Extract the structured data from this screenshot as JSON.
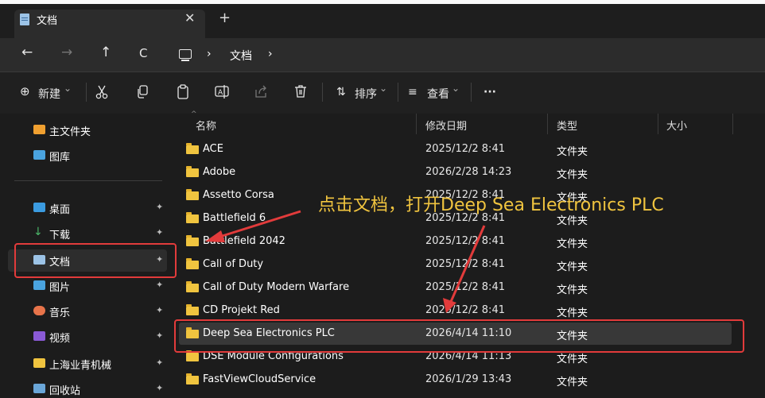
{
  "window": {
    "tab_title": "文档",
    "tab_close": "✕",
    "new_tab": "+"
  },
  "nav": {
    "back": "←",
    "forward": "→",
    "up": "↑",
    "refresh": "C",
    "crumb_chevron_1": "›",
    "crumb_current": "文档",
    "crumb_chevron_2": "›"
  },
  "toolbar": {
    "new_icon": "⊕",
    "new_label": "新建",
    "new_chevron": "⌄",
    "sort_icon": "⇅",
    "sort_label": "排序",
    "sort_chevron": "⌄",
    "view_icon": "≡",
    "view_label": "查看",
    "view_chevron": "⌄",
    "more": "···"
  },
  "sidebar": {
    "items": [
      {
        "label": "主文件夹",
        "icon": "home-icon",
        "pinned": false
      },
      {
        "label": "图库",
        "icon": "gallery-icon",
        "pinned": false
      },
      {
        "label": "桌面",
        "icon": "desktop-icon",
        "pinned": true
      },
      {
        "label": "下载",
        "icon": "download-icon",
        "pinned": true
      },
      {
        "label": "文档",
        "icon": "documents-icon",
        "pinned": true,
        "selected": true
      },
      {
        "label": "图片",
        "icon": "pictures-icon",
        "pinned": true
      },
      {
        "label": "音乐",
        "icon": "music-icon",
        "pinned": true
      },
      {
        "label": "视频",
        "icon": "video-icon",
        "pinned": true
      },
      {
        "label": "上海业青机械",
        "icon": "folder-icon",
        "pinned": true
      },
      {
        "label": "回收站",
        "icon": "recycle-bin-icon",
        "pinned": true
      }
    ],
    "pin_glyph": "📌"
  },
  "columns": {
    "name": "名称",
    "modified": "修改日期",
    "type": "类型",
    "size": "大小"
  },
  "files": [
    {
      "name": "ACE",
      "modified": "2025/12/2 8:41",
      "type": "文件夹"
    },
    {
      "name": "Adobe",
      "modified": "2026/2/28 14:23",
      "type": "文件夹"
    },
    {
      "name": "Assetto Corsa",
      "modified": "2025/12/2 8:41",
      "type": "文件夹"
    },
    {
      "name": "Battlefield 6",
      "modified": "2025/12/2 8:41",
      "type": "文件夹"
    },
    {
      "name": "Battlefield 2042",
      "modified": "2025/12/2 8:41",
      "type": "文件夹"
    },
    {
      "name": "Call of Duty",
      "modified": "2025/12/2 8:41",
      "type": "文件夹"
    },
    {
      "name": "Call of Duty Modern Warfare",
      "modified": "2025/12/2 8:41",
      "type": "文件夹"
    },
    {
      "name": "CD Projekt Red",
      "modified": "2025/12/2 8:41",
      "type": "文件夹"
    },
    {
      "name": "Deep Sea Electronics PLC",
      "modified": "2026/4/14 11:10",
      "type": "文件夹",
      "selected": true
    },
    {
      "name": "DSE Module Configurations",
      "modified": "2026/4/14 11:13",
      "type": "文件夹"
    },
    {
      "name": "FastViewCloudService",
      "modified": "2026/1/29 13:43",
      "type": "文件夹"
    }
  ],
  "annotation": {
    "text": "点击文档，打开Deep Sea Electronics PLC",
    "color": "#f0c43f",
    "highlight_color": "#e23b3b"
  }
}
